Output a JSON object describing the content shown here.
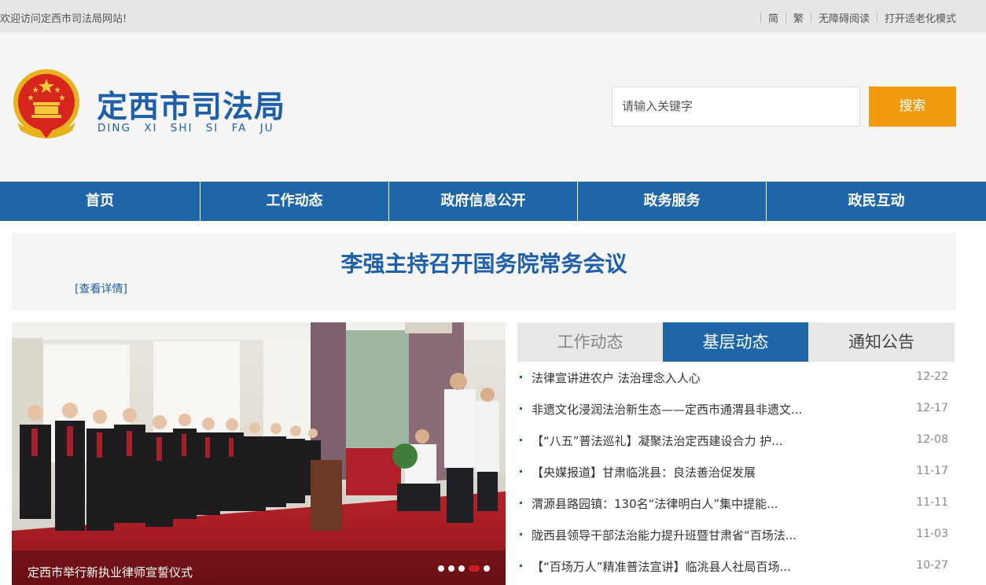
{
  "topbar": {
    "welcome": "欢迎访问定西市司法局网站!",
    "links": [
      "简",
      "繁",
      "无障碍阅读",
      "打开适老化模式"
    ]
  },
  "header": {
    "title": "定西市司法局",
    "pinyin": "DING XI SHI SI FA JU",
    "search_placeholder": "请输入关键字",
    "search_button": "搜索"
  },
  "nav": [
    "首页",
    "工作动态",
    "政府信息公开",
    "政务服务",
    "政民互动"
  ],
  "headline": {
    "title": "李强主持召开国务院常务会议",
    "detail": "[查看详情]"
  },
  "slider": {
    "caption": "定西市举行新执业律师宣誓仪式",
    "dots": 5,
    "active_dot": 4
  },
  "tabs": [
    {
      "label": "工作动态",
      "active": false
    },
    {
      "label": "基层动态",
      "active": true
    },
    {
      "label": "通知公告",
      "active": false
    }
  ],
  "news": [
    {
      "title": "法律宣讲进农户 法治理念入人心",
      "date": "12-22"
    },
    {
      "title": "非遗文化浸润法治新生态——定西市通渭县非遗文...",
      "date": "12-17"
    },
    {
      "title": "【“八五”普法巡礼】凝聚法治定西建设合力 护...",
      "date": "12-08"
    },
    {
      "title": "【央媒报道】甘肃临洮县：良法善治促发展",
      "date": "11-17"
    },
    {
      "title": "渭源县路园镇：130名“法律明白人”集中提能...",
      "date": "11-11"
    },
    {
      "title": "陇西县领导干部法治能力提升班暨甘肃省“百场法...",
      "date": "11-03"
    },
    {
      "title": "【“百场万人”精准普法宣讲】临洮县人社局百场...",
      "date": "10-27"
    }
  ],
  "colors": {
    "brand": "#1f5fa8",
    "nav": "#1f66a8",
    "search": "#f29a0e",
    "active_dot": "#c71e23"
  }
}
